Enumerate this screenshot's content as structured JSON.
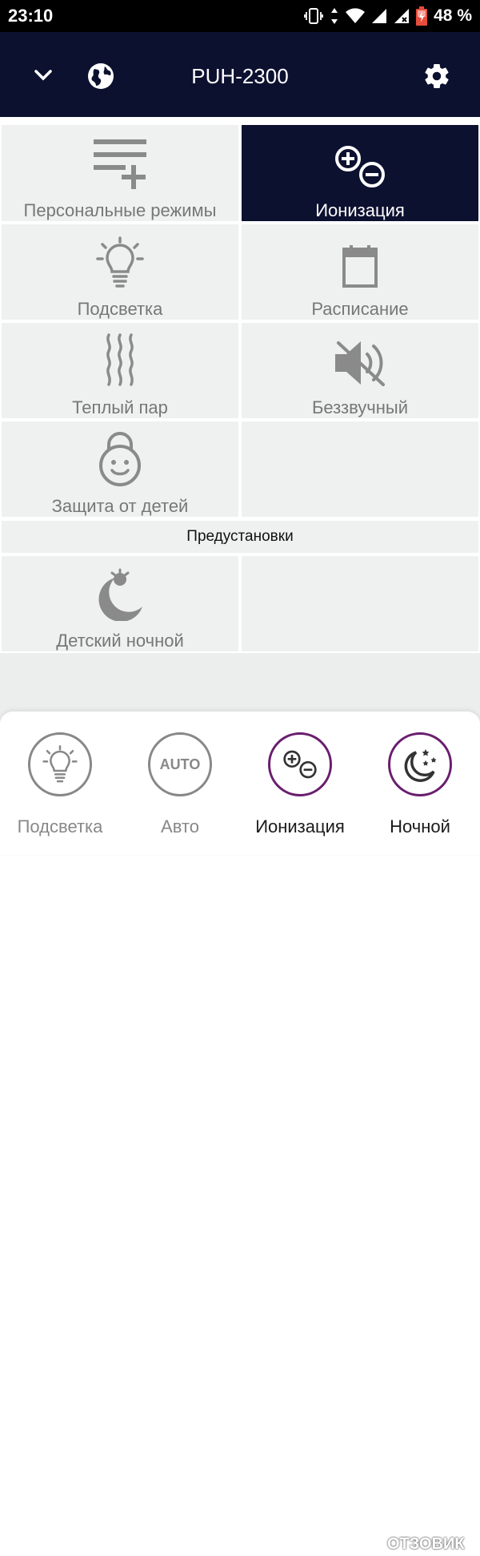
{
  "status": {
    "time": "23:10",
    "battery_percent": "48 %",
    "icons": [
      "vibrate-icon",
      "data-arrows-icon",
      "wifi-icon",
      "signal-icon",
      "signal-x-icon",
      "battery-charging-icon"
    ]
  },
  "header": {
    "title": "PUH-2300",
    "icons": [
      "chevron-down-icon",
      "globe-icon",
      "gear-icon"
    ]
  },
  "tiles": [
    {
      "id": "personal-modes",
      "label": "Персональные режимы",
      "icon": "playlist-add-icon",
      "active": false
    },
    {
      "id": "ionization",
      "label": "Ионизация",
      "icon": "plus-minus-icon",
      "active": true
    },
    {
      "id": "backlight",
      "label": "Подсветка",
      "icon": "lightbulb-icon",
      "active": false
    },
    {
      "id": "schedule",
      "label": "Расписание",
      "icon": "calendar-icon",
      "active": false
    },
    {
      "id": "warm-steam",
      "label": "Теплый пар",
      "icon": "steam-icon",
      "active": false
    },
    {
      "id": "silent",
      "label": "Беззвучный",
      "icon": "mute-icon",
      "active": false
    },
    {
      "id": "child-lock",
      "label": "Защита от детей",
      "icon": "child-lock-icon",
      "active": false
    }
  ],
  "presets": {
    "header": "Предустановки",
    "items": [
      {
        "id": "child-night",
        "label": "Детский ночной",
        "icon": "sleeping-child-moon-icon"
      }
    ]
  },
  "modes": [
    {
      "id": "backlight",
      "label": "Подсветка",
      "icon": "lightbulb-icon",
      "active": false
    },
    {
      "id": "auto",
      "label": "Авто",
      "icon_text": "AUTO",
      "active": false
    },
    {
      "id": "ionization",
      "label": "Ионизация",
      "icon": "plus-minus-icon",
      "active": true
    },
    {
      "id": "night",
      "label": "Ночной",
      "icon": "moon-stars-icon",
      "active": true
    }
  ],
  "watermark": {
    "text": "ОТЗОВИК"
  },
  "colors": {
    "header_bg": "#0d1130",
    "tile_bg": "#eff0f0",
    "active_ring": "#6a1e6e",
    "icon_gray": "#8a8a8a"
  }
}
